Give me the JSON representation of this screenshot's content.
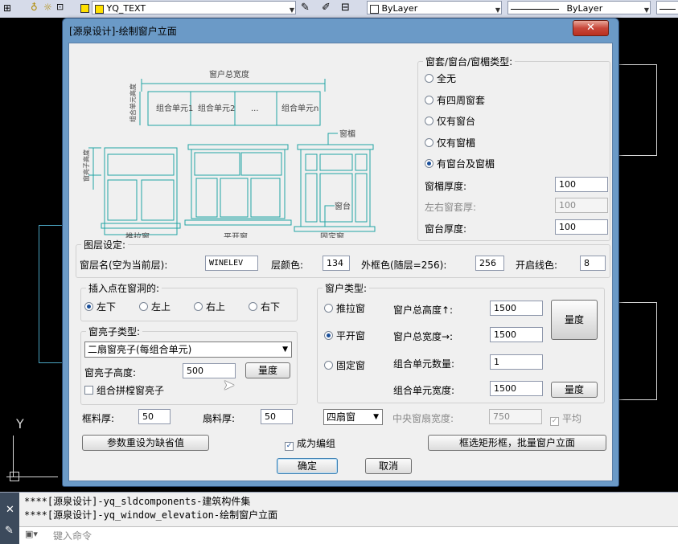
{
  "toolbar": {
    "layer_text": "YQ_TEXT",
    "color_text": "ByLayer",
    "linetype_text": "ByLayer"
  },
  "cad": {
    "axis_y_label": "Y"
  },
  "command": {
    "history": [
      "****[源泉设计]-yq_sldcomponents-建筑构件集",
      "****[源泉设计]-yq_window_elevation-绘制窗户立面"
    ],
    "input_placeholder": "键入命令"
  },
  "dialog": {
    "title": "[源泉设计]-绘制窗户立面",
    "close_label": "✕",
    "preview": {
      "total_width": "窗户总宽度",
      "unit_height": "组合单元高度",
      "units": [
        "组合单元1",
        "组合单元2",
        "...",
        "组合单元n"
      ],
      "bright_height": "窗亮子高度",
      "sill_label": "窗台",
      "hood_label": "窗楣",
      "type_sliding": "推拉窗",
      "type_casement": "平开窗",
      "type_fixed": "固定窗"
    },
    "trim": {
      "title": "窗套/窗台/窗楣类型:",
      "options": [
        "全无",
        "有四周窗套",
        "仅有窗台",
        "仅有窗楣",
        "有窗台及窗楣"
      ],
      "selected_index": 4,
      "hood_thickness_label": "窗楣厚度:",
      "hood_thickness": "100",
      "side_trim_label": "左右窗套厚:",
      "side_trim": "100",
      "sill_thickness_label": "窗台厚度:",
      "sill_thickness": "100"
    },
    "layer": {
      "title": "图层设定:",
      "name_label": "窗层名(空为当前层):",
      "name_value": "WINELEV",
      "color_label": "层颜色:",
      "color_value": "134",
      "outer_color_label": "外框色(随层=256):",
      "outer_color_value": "256",
      "open_line_label": "开启线色:",
      "open_line_value": "8"
    },
    "insert": {
      "title": "插入点在窗洞的:",
      "options": [
        "左下",
        "左上",
        "右上",
        "右下"
      ],
      "selected_index": 0
    },
    "bright": {
      "title": "窗亮子类型:",
      "type_value": "二扇窗亮子(每组合单元)",
      "height_label": "窗亮子高度:",
      "height_value": "500",
      "measure_label": "量度",
      "combo_label": "组合拼樘窗亮子"
    },
    "frame_label": "框料厚:",
    "frame_value": "50",
    "sash_label": "扇料厚:",
    "sash_value": "50",
    "window_type": {
      "title": "窗户类型:",
      "options": [
        "推拉窗",
        "平开窗",
        "固定窗"
      ],
      "selected_index": 1,
      "total_height_label": "窗户总高度↑:",
      "total_height": "1500",
      "total_width_label": "窗户总宽度→:",
      "total_width": "1500",
      "unit_count_label": "组合单元数量:",
      "unit_count": "1",
      "unit_width_label": "组合单元宽度:",
      "unit_width": "1500",
      "measure_big_label": "量度",
      "measure_small_label": "量度",
      "sash_select": "四扇窗",
      "center_width_label": "中央窗扇宽度:",
      "center_width": "750",
      "average_label": "平均"
    },
    "reset_label": "参数重设为缺省值",
    "group_label": "成为编组",
    "batch_label": "框选矩形框，批量窗户立面",
    "ok_label": "确定",
    "cancel_label": "取消"
  }
}
